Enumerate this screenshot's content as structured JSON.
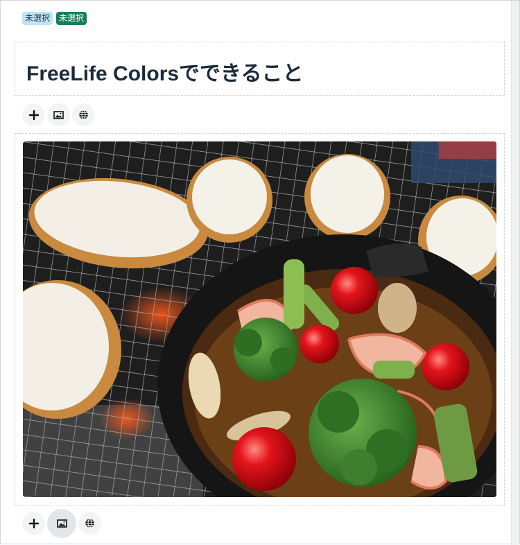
{
  "badges": {
    "status_light": "未選択",
    "status_dark": "未選択"
  },
  "heading": {
    "title": "FreeLife Colorsでできること"
  },
  "toolbar_top": {
    "icons": [
      "plus-icon",
      "image-icon",
      "globe-icon"
    ]
  },
  "image_block": {
    "alt": "Cast-iron skillet of ajillo with shrimp, broccoli, cherry tomatoes and mushrooms on a grill grate beside toasted baguette slices"
  },
  "toolbar_bottom": {
    "icons": [
      "plus-icon",
      "image-icon",
      "globe-icon"
    ],
    "active": "image-icon"
  },
  "colors": {
    "badge_light": "#bfe3f2",
    "badge_dark": "#12805c",
    "title": "#1a2b3c",
    "toolbar_button": "#f3f4f6"
  }
}
